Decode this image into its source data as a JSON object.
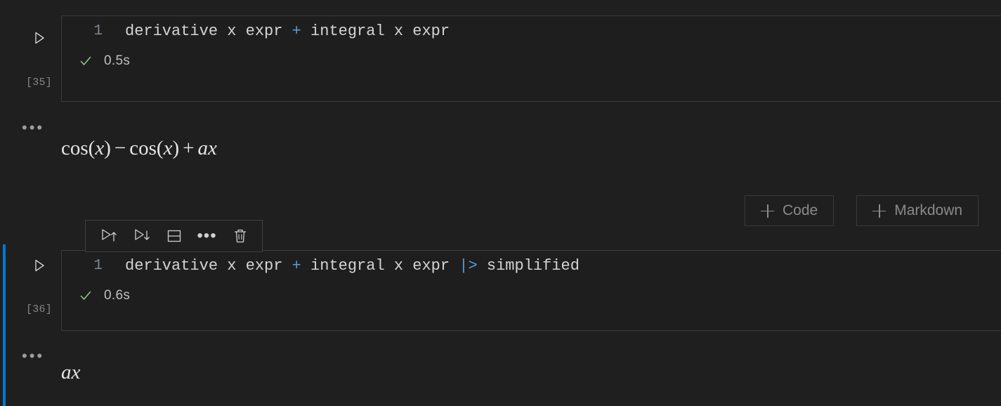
{
  "theme": {
    "background": "#1f1f1f",
    "cell_background": "#1e1e1e",
    "cell_border": "#3b3b42",
    "focus_bar": "#0078d4",
    "success_green": "#89d185",
    "operator_blue": "#569cd6",
    "text": "#d4d4d4",
    "muted_text": "#868686"
  },
  "cells": [
    {
      "run_icon": "play-triangle-icon",
      "execution_count": "[35]",
      "line_number": "1",
      "code": {
        "before_op": "derivative x expr ",
        "op": "+",
        "after_op": " integral x expr"
      },
      "status": {
        "icon": "check-icon",
        "duration": "0.5s"
      },
      "output": {
        "dots": "…",
        "latex_parts": [
          {
            "text": "cos(",
            "style": "roman"
          },
          {
            "text": "x",
            "style": "italic"
          },
          {
            "text": ")",
            "style": "roman"
          },
          {
            "text": "−",
            "style": "operator"
          },
          {
            "text": "cos(",
            "style": "roman"
          },
          {
            "text": "x",
            "style": "italic"
          },
          {
            "text": ")",
            "style": "roman"
          },
          {
            "text": "+",
            "style": "operator"
          },
          {
            "text": "ax",
            "style": "italic"
          }
        ],
        "plain": "cos(x) − cos(x) + ax"
      }
    },
    {
      "run_icon": "play-triangle-icon",
      "execution_count": "[36]",
      "line_number": "1",
      "code": {
        "before_op": "derivative x expr ",
        "op": "+",
        "after_op": " integral x expr ",
        "op2": "|>",
        "after_op2": " simplified"
      },
      "status": {
        "icon": "check-icon",
        "duration": "0.6s"
      },
      "output": {
        "dots": "…",
        "latex_parts": [
          {
            "text": "ax",
            "style": "italic"
          }
        ],
        "plain": "ax"
      },
      "selected": true
    }
  ],
  "insert_buttons": [
    {
      "icon": "plus-icon",
      "label": "Code"
    },
    {
      "icon": "plus-icon",
      "label": "Markdown"
    }
  ],
  "cell_toolbar": {
    "buttons": [
      {
        "icon": "run-above-icon",
        "tooltip": "Execute Above Cells"
      },
      {
        "icon": "run-below-icon",
        "tooltip": "Execute Cell and Below"
      },
      {
        "icon": "split-cell-icon",
        "tooltip": "Split Cell"
      },
      {
        "icon": "more-actions-icon",
        "tooltip": "More Actions",
        "glyph": "•••"
      },
      {
        "icon": "delete-cell-icon",
        "tooltip": "Delete Cell"
      }
    ]
  }
}
